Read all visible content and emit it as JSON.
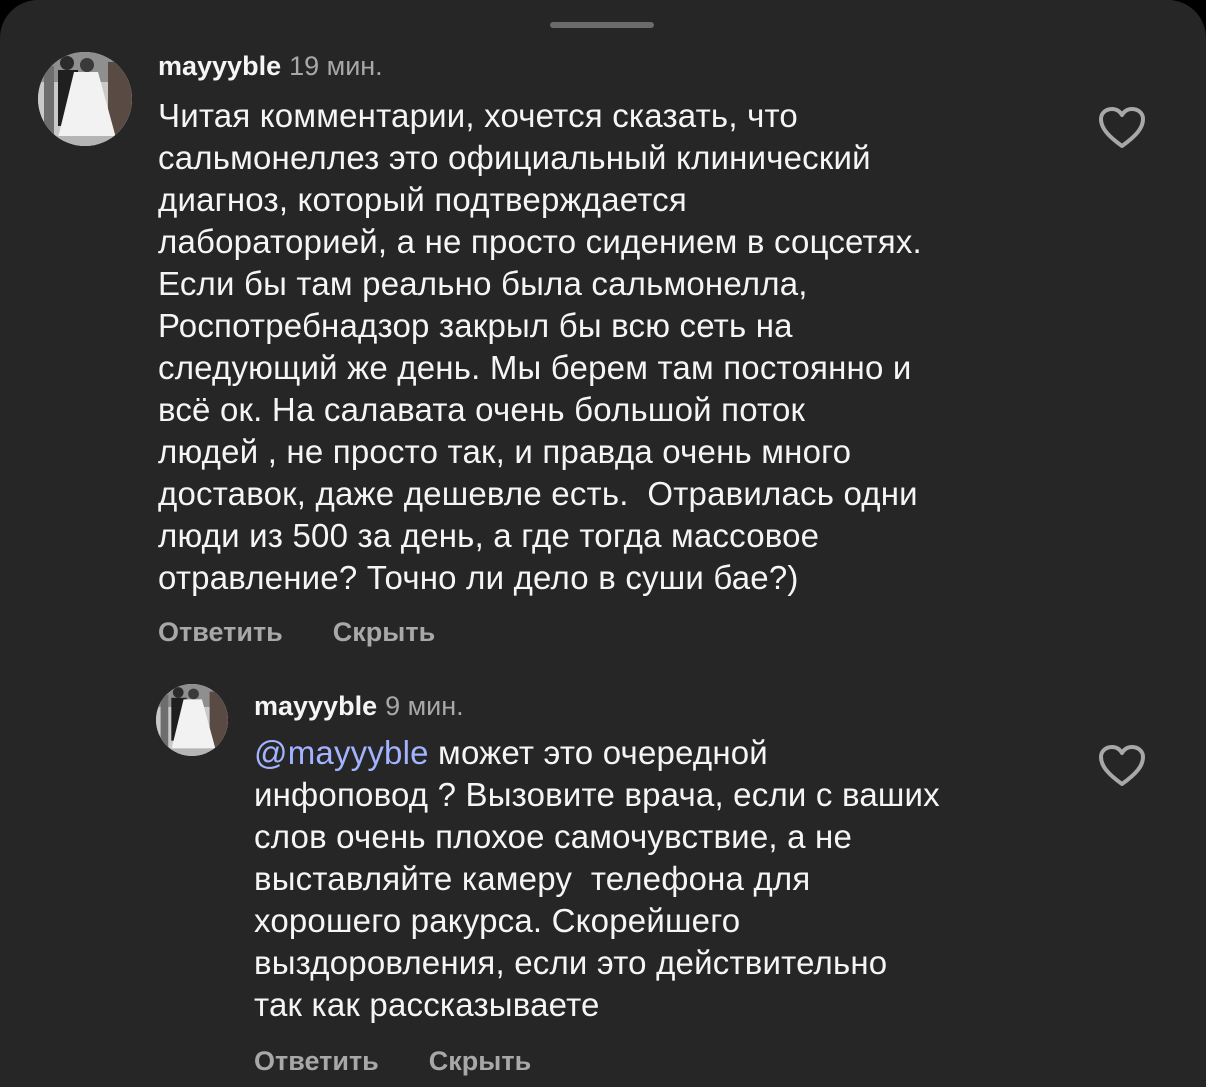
{
  "comments": [
    {
      "username": "mayyyble",
      "time": "19 мин.",
      "text": "Читая комментарии, хочется сказать, что\nсальмонеллез это официальный клинический\nдиагноз, который подтверждается\nлабораторией, а не просто сидением в соцсетях.\nЕсли бы там реально была сальмонелла,\nРоспотребнадзор закрыл бы всю сеть на\nследующий же день. Мы берем там постоянно и\nвсё ок. На салавата очень большой поток\nлюдей , не просто так, и правда очень много\nдоставок, даже дешевле есть.  Отравилась одни\nлюди из 500 за день, а где тогда массовое\nотравление? Точно ли дело в суши бае?)",
      "reply_label": "Ответить",
      "hide_label": "Скрыть",
      "like_icon": "heart-outline-icon"
    },
    {
      "username": "mayyyble",
      "time": "9 мин.",
      "mention": "@mayyyble",
      "text": " может это очередной\nинфоповод ? Вызовите врача, если с ваших\nслов очень плохое самочувствие, а не\nвыставляйте камеру  телефона для\nхорошего ракурса. Скорейшего\nвыздоровления, если это действительно\nтак как рассказываете",
      "reply_label": "Ответить",
      "hide_label": "Скрыть",
      "like_icon": "heart-outline-icon"
    }
  ],
  "colors": {
    "background": "#262626",
    "primary_text": "#f5f5f5",
    "secondary_text": "#a8a8a8",
    "mention": "#a3b3ff"
  }
}
